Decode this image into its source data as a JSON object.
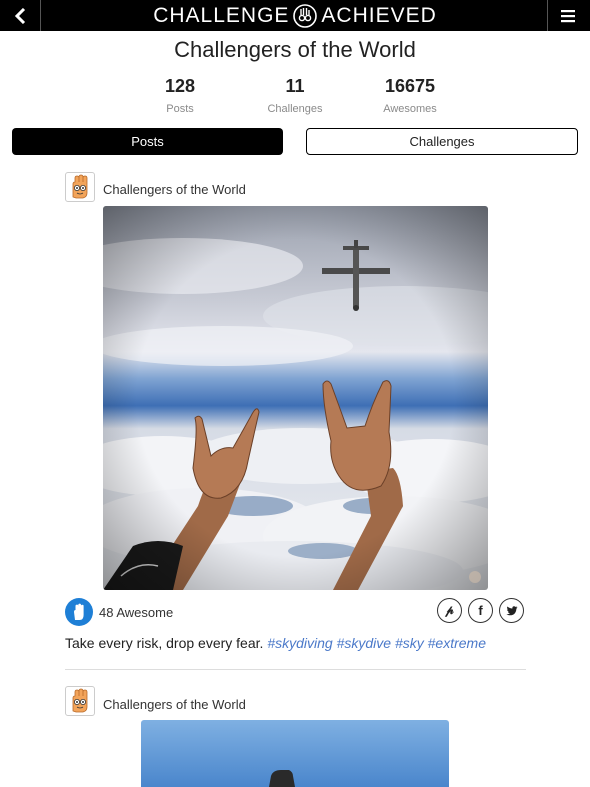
{
  "header": {
    "logo_left": "CHALLENGE",
    "logo_right": "ACHIEVED",
    "back_icon": "chevron-left-icon",
    "menu_icon": "hamburger-menu-icon"
  },
  "profile": {
    "title": "Challengers of the World",
    "stats": [
      {
        "value": "128",
        "label": "Posts"
      },
      {
        "value": "11",
        "label": "Challenges"
      },
      {
        "value": "16675",
        "label": "Awesomes"
      }
    ]
  },
  "tabs": {
    "posts": "Posts",
    "challenges": "Challenges"
  },
  "posts": [
    {
      "author": "Challengers of the World",
      "awesome_count": "48 Awesome",
      "caption": "Take every risk, drop every fear.",
      "hashtags": [
        "#skydiving",
        "#skydive",
        "#sky",
        "#extreme"
      ],
      "share_icons": [
        "pinterest-icon",
        "facebook-icon",
        "twitter-icon"
      ]
    },
    {
      "author": "Challengers of the World"
    }
  ],
  "colors": {
    "accent_blue": "#1e7fd6",
    "hashtag": "#4b79c9",
    "topbar": "#000000"
  }
}
